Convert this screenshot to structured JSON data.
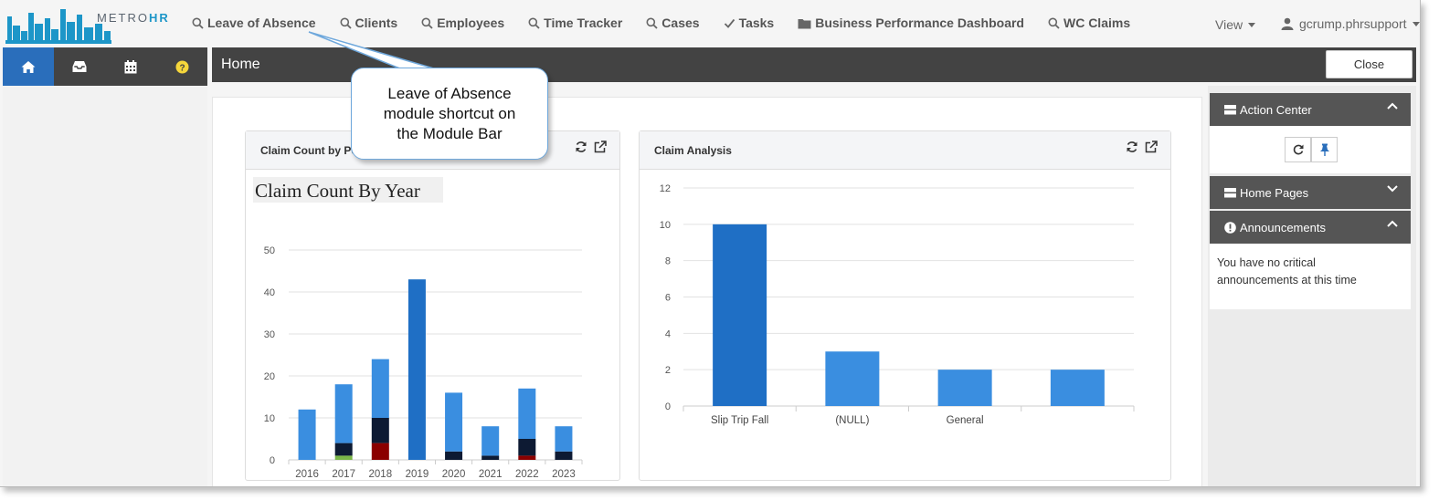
{
  "app": {
    "logo_text_light": "METRO",
    "logo_text_bold": "HR",
    "brand_color": "#1d96c8"
  },
  "modules": [
    {
      "label": "Leave of Absence",
      "icon": "search-icon"
    },
    {
      "label": "Clients",
      "icon": "search-icon"
    },
    {
      "label": "Employees",
      "icon": "search-icon"
    },
    {
      "label": "Time Tracker",
      "icon": "search-icon"
    },
    {
      "label": "Cases",
      "icon": "search-icon"
    },
    {
      "label": "Tasks",
      "icon": "check-icon"
    },
    {
      "label": "Business Performance Dashboard",
      "icon": "folder-icon"
    },
    {
      "label": "WC Claims",
      "icon": "search-icon"
    }
  ],
  "header": {
    "view_label": "View",
    "user_label": "gcrump.phrsupport"
  },
  "left_tabs": [
    "home-icon",
    "inbox-icon",
    "calendar-icon",
    "help-icon"
  ],
  "home": {
    "title": "Home",
    "close_label": "Close"
  },
  "widgets": {
    "claim_count": {
      "title": "Claim Count by Po"
    },
    "claim_analysis": {
      "title": "Claim Analysis"
    }
  },
  "right_pane": {
    "action_center": "Action Center",
    "home_pages": "Home Pages",
    "announcements": "Announcements",
    "announcement_text": "You have no critical announcements at this time"
  },
  "callout": {
    "text_lines": [
      "Leave of Absence",
      "module shortcut on",
      "the Module Bar"
    ]
  },
  "colors": {
    "primary_bar": "#1f6fc5",
    "secondary_bar": "#3a8ee0",
    "dark_segment": "#0d1a33",
    "red_segment": "#8b0000",
    "green_segment": "#7ab648",
    "header_dark": "#434343",
    "active_tab": "#2a6ebb"
  },
  "chart_data": [
    {
      "type": "bar",
      "title": "Claim Count By Year",
      "categories": [
        "2016",
        "2017",
        "2018",
        "2019",
        "2020",
        "2021",
        "2022",
        "2023"
      ],
      "series": [
        {
          "values": [
            12,
            14,
            14,
            43,
            14,
            7,
            12,
            6
          ],
          "color": "#3a8ee0"
        },
        {
          "values": [
            0,
            3,
            6,
            0,
            2,
            1,
            4,
            2
          ],
          "color": "#0d1a33"
        },
        {
          "values": [
            0,
            0,
            4,
            0,
            0,
            0,
            1,
            0
          ],
          "color": "#8b0000"
        },
        {
          "values": [
            0,
            1,
            0,
            0,
            0,
            0,
            0,
            0
          ],
          "color": "#7ab648"
        }
      ],
      "highlight_category": "2019",
      "yticks": [
        0,
        10,
        20,
        30,
        40,
        50
      ],
      "ylim": [
        0,
        50
      ],
      "stacked": true,
      "grid": true
    },
    {
      "type": "bar",
      "categories": [
        "Slip Trip Fall",
        "(NULL)",
        "General",
        ""
      ],
      "values": [
        10,
        3,
        2,
        2
      ],
      "highlight_category": "Slip Trip Fall",
      "yticks": [
        0,
        2,
        4,
        6,
        8,
        10,
        12
      ],
      "ylim": [
        0,
        12
      ],
      "grid": true
    }
  ]
}
